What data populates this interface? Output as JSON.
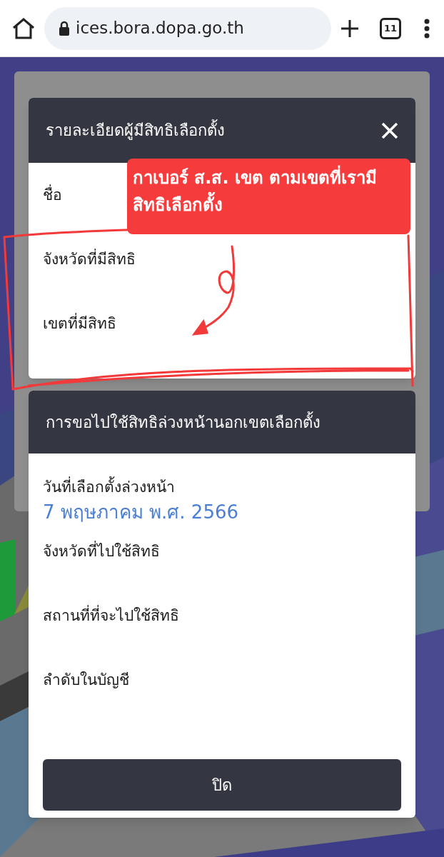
{
  "browser": {
    "url": "ices.bora.dopa.go.th",
    "tab_count": "11"
  },
  "details_dialog": {
    "title": "รายละเอียดผู้มีสิทธิเลือกตั้ง",
    "fields": [
      {
        "label": "ชื่อ"
      },
      {
        "label": "จังหวัดที่มีสิทธิ"
      },
      {
        "label": "เขตที่มีสิทธิ"
      }
    ]
  },
  "annotation": {
    "text": "กาเบอร์ ส.ส. เขต ตามเขตที่เรามีสิทธิเลือกตั้ง"
  },
  "advance_dialog": {
    "title": "การขอไปใช้สิทธิล่วงหน้านอกเขตเลือกตั้ง",
    "fields": [
      {
        "label": "วันที่เลือกตั้งล่วงหน้า",
        "value": "7 พฤษภาคม พ.ศ. 2566"
      },
      {
        "label": "จังหวัดที่ไปใช้สิทธิ"
      },
      {
        "label": "สถานที่ที่จะไปใช้สิทธิ"
      },
      {
        "label": "ลำดับในบัญชี"
      }
    ],
    "close_button": "ปิด"
  }
}
